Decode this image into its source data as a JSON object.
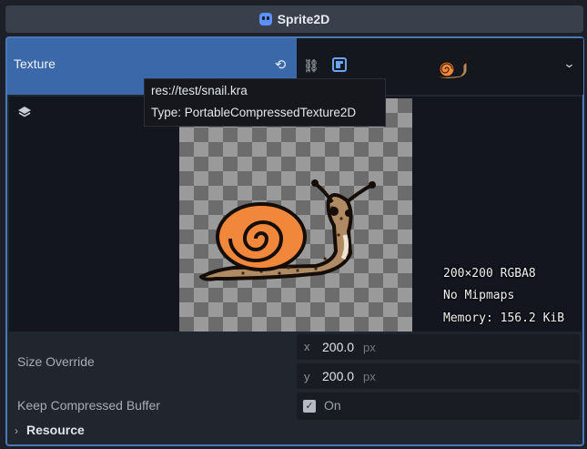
{
  "header": {
    "title": "Sprite2D",
    "icon": "sprite2d-icon"
  },
  "texture_property": {
    "label": "Texture",
    "revert_icon": "revert-icon",
    "link_icon": "link-icon",
    "compress_icon": "compressed-texture-icon",
    "dropdown_icon": "chevron-down-icon"
  },
  "tooltip": {
    "path": "res://test/snail.kra",
    "type": "Type: PortableCompressedTexture2D"
  },
  "preview": {
    "layers_icon": "layers-icon",
    "info": [
      "200×200 RGBA8",
      "No Mipmaps",
      "Memory: 156.2 KiB"
    ]
  },
  "size_override": {
    "label": "Size Override",
    "x_axis": "x",
    "x_value": "200.0",
    "x_unit": "px",
    "y_axis": "y",
    "y_value": "200.0",
    "y_unit": "px"
  },
  "keep_compressed": {
    "label": "Keep Compressed Buffer",
    "checked": true,
    "value_text": "On"
  },
  "resource": {
    "label": "Resource",
    "expand_icon": "chevron-right-icon"
  },
  "colors": {
    "accent": "#3b68a8",
    "panel_border": "#4b78b9",
    "snail_shell": "#f0873a",
    "snail_body": "#b08a63"
  }
}
